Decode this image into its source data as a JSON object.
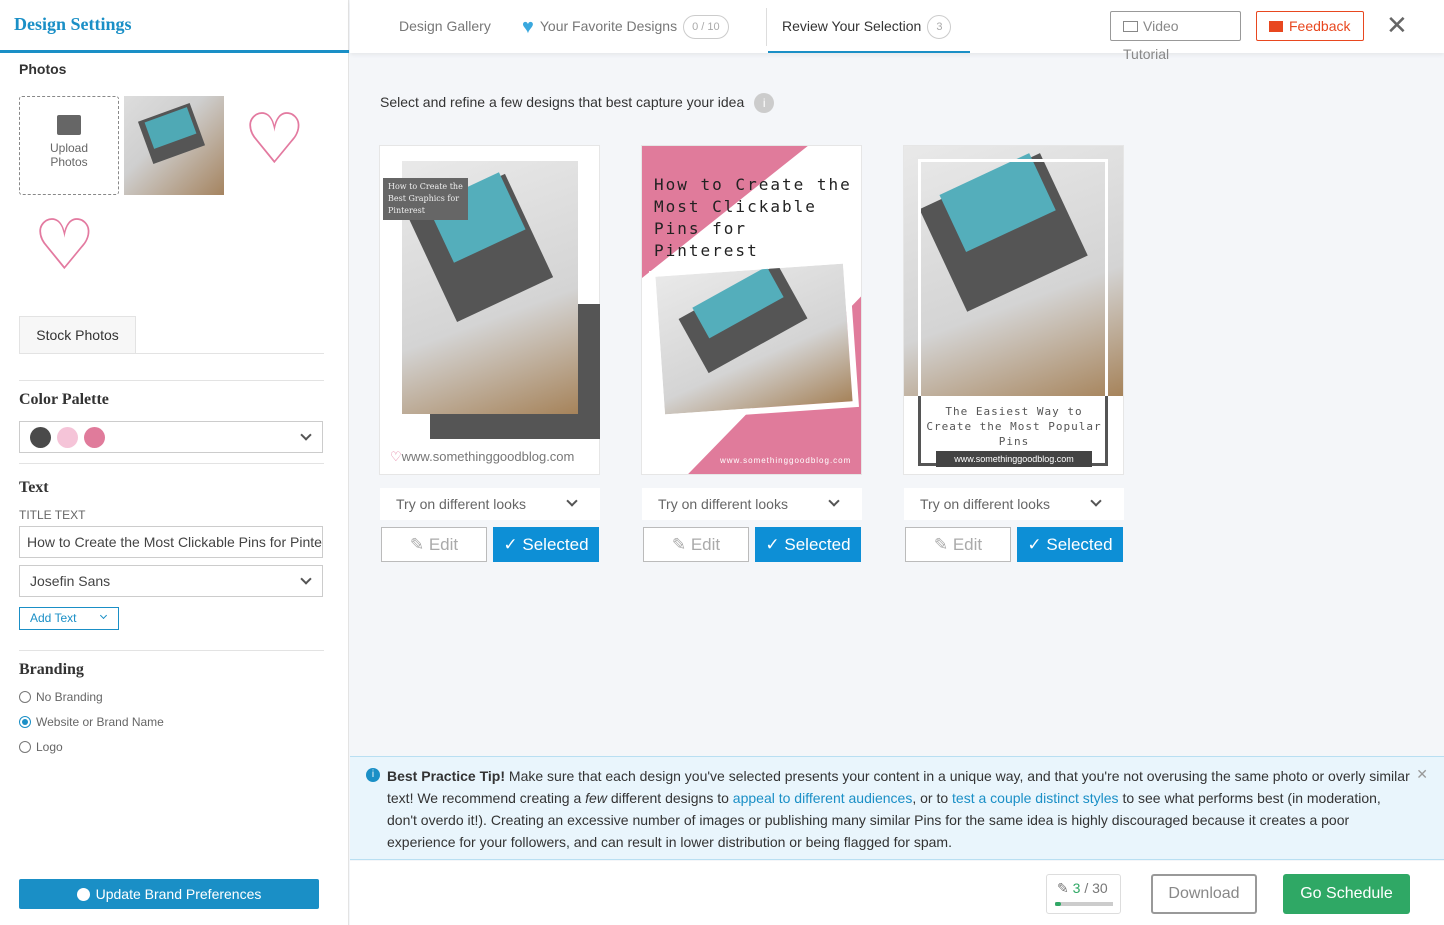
{
  "sidebar": {
    "title": "Design Settings",
    "photos_label": "Photos",
    "upload_label": "Upload Photos",
    "stock_label": "Stock Photos",
    "color_palette_label": "Color Palette",
    "palette": [
      "#4a4a4a",
      "#f5c4d8",
      "#e07b9b"
    ],
    "text_label": "Text",
    "title_text_label": "TITLE TEXT",
    "title_text_value": "How to Create the Most Clickable Pins for Pinterest",
    "font_value": "Josefin Sans",
    "add_text_label": "Add Text",
    "branding_label": "Branding",
    "branding_options": [
      {
        "label": "No Branding",
        "selected": false
      },
      {
        "label": "Website or Brand Name",
        "selected": true
      },
      {
        "label": "Logo",
        "selected": false
      }
    ],
    "update_button": "Update Brand Preferences"
  },
  "header": {
    "tabs": [
      {
        "label": "Design Gallery"
      },
      {
        "label": "Your Favorite Designs",
        "badge": "0 / 10"
      },
      {
        "label": "Review Your Selection",
        "badge": "3",
        "active": true
      }
    ],
    "video_tutorial": "Video Tutorial",
    "feedback": "Feedback"
  },
  "main": {
    "instruction": "Select and refine a few designs that best capture your idea",
    "designs": [
      {
        "title": "How to Create the Best Graphics for Pinterest",
        "url": "www.somethinggoodblog.com",
        "looks": "Try on different looks",
        "edit": "Edit",
        "selected": "Selected"
      },
      {
        "title": "How to Create the Most Clickable Pins for Pinterest",
        "url": "www.somethinggoodblog.com",
        "looks": "Try on different looks",
        "edit": "Edit",
        "selected": "Selected"
      },
      {
        "title": "The Easiest Way to Create the Most Popular Pins",
        "url": "www.somethinggoodblog.com",
        "looks": "Try on different looks",
        "edit": "Edit",
        "selected": "Selected"
      }
    ]
  },
  "tip": {
    "bold": "Best Practice Tip!",
    "t1": " Make sure that each design you've selected presents your content in a unique way, and that you're not overusing the same photo or overly similar text! We recommend creating a ",
    "em": "few",
    "t2": " different designs to ",
    "link1": "appeal to different audiences",
    "t3": ", or to ",
    "link2": "test a couple distinct styles",
    "t4": " to see what performs best (in moderation, don't overdo it!). Creating an excessive number of images or publishing many similar Pins for the same idea is highly discouraged because it creates a poor experience for your followers, and can result in lower distribution or being flagged for spam."
  },
  "footer": {
    "count": "3",
    "total": "/ 30",
    "progress": 0.1,
    "download": "Download",
    "go_schedule": "Go Schedule"
  },
  "colors": {
    "accent": "#1a8fc6",
    "selected": "#0d8fd6",
    "go": "#2fa865",
    "feedback": "#e8471f",
    "pink": "#e07b9b"
  }
}
